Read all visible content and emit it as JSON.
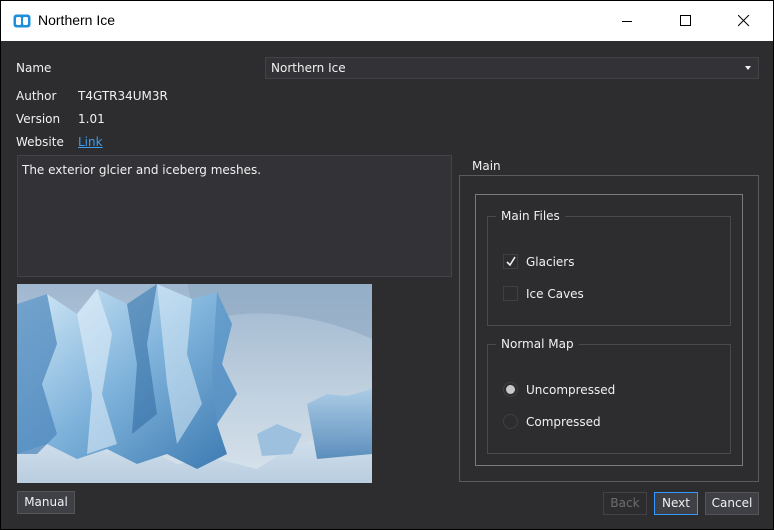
{
  "window": {
    "title": "Northern Ice",
    "icon": "app-logo-icon",
    "controls": [
      "minimize-icon",
      "maximize-icon",
      "close-icon"
    ]
  },
  "info": {
    "name_label": "Name",
    "name_value": "Northern Ice",
    "author_label": "Author",
    "author_value": "T4GTR34UM3R",
    "version_label": "Version",
    "version_value": "1.01",
    "website_label": "Website",
    "website_link": "Link"
  },
  "description": "The exterior glcier and iceberg meshes.",
  "options": {
    "group_title": "Main",
    "main_files": {
      "title": "Main Files",
      "items": [
        {
          "label": "Glaciers",
          "checked": true
        },
        {
          "label": "Ice Caves",
          "checked": false
        }
      ]
    },
    "normal_map": {
      "title": "Normal Map",
      "items": [
        {
          "label": "Uncompressed",
          "selected": true
        },
        {
          "label": "Compressed",
          "selected": false
        }
      ]
    }
  },
  "buttons": {
    "manual": "Manual",
    "back": "Back",
    "next": "Next",
    "cancel": "Cancel"
  },
  "colors": {
    "background": "#2d2d30",
    "link": "#3d9ef0",
    "focus_border": "#3399ff"
  }
}
